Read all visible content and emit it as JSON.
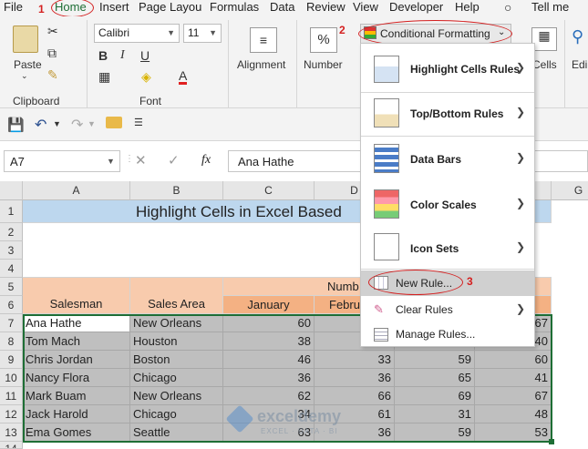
{
  "tabs": [
    {
      "label": "File"
    },
    {
      "label": "Home"
    },
    {
      "label": "Insert"
    },
    {
      "label": "Page Layou"
    },
    {
      "label": "Formulas"
    },
    {
      "label": "Data"
    },
    {
      "label": "Review"
    },
    {
      "label": "View"
    },
    {
      "label": "Developer"
    },
    {
      "label": "Help"
    },
    {
      "label": "Tell me"
    }
  ],
  "markers": {
    "m1": "1",
    "m2": "2",
    "m3": "3"
  },
  "ribbon": {
    "paste_label": "Paste",
    "clipboard_label": "Clipboard",
    "font_name": "Calibri",
    "font_size": "11",
    "bold": "B",
    "italic": "I",
    "underline": "U",
    "font_color_glyph": "A",
    "font_label": "Font",
    "alignment_label": "Alignment",
    "number_label": "Number",
    "percent_glyph": "%",
    "cf_button_label": "Conditional Formatting",
    "cells_label": "Cells",
    "editing_label": "Edi"
  },
  "formula_bar": {
    "name_box": "A7",
    "fx": "fx",
    "value": "Ana Hathe"
  },
  "columns": [
    "A",
    "B",
    "C",
    "D",
    "E",
    "F",
    "G"
  ],
  "rows": [
    "1",
    "2",
    "3",
    "4",
    "5",
    "6",
    "7",
    "8",
    "9",
    "10",
    "11",
    "12",
    "13",
    "14"
  ],
  "sheet": {
    "title": "Highlight Cells in Excel Based",
    "number_header": "Numb",
    "salesman_header": "Salesman",
    "area_header": "Sales Area",
    "january_header": "January",
    "february_header": "Febru",
    "data": [
      {
        "name": "Ana Hathe",
        "area": "New Orleans",
        "c": "60",
        "d": "",
        "e": "",
        "f": "67"
      },
      {
        "name": "Tom Mach",
        "area": "Houston",
        "c": "38",
        "d": "",
        "e": "",
        "f": "40"
      },
      {
        "name": "Chris Jordan",
        "area": "Boston",
        "c": "46",
        "d": "33",
        "e": "59",
        "f": "60"
      },
      {
        "name": "Nancy Flora",
        "area": "Chicago",
        "c": "36",
        "d": "36",
        "e": "65",
        "f": "41"
      },
      {
        "name": "Mark Buam",
        "area": "New Orleans",
        "c": "62",
        "d": "66",
        "e": "69",
        "f": "67"
      },
      {
        "name": "Jack Harold",
        "area": "Chicago",
        "c": "34",
        "d": "61",
        "e": "31",
        "f": "48"
      },
      {
        "name": "Ema Gomes",
        "area": "Seattle",
        "c": "63",
        "d": "36",
        "e": "59",
        "f": "53"
      }
    ]
  },
  "menu": {
    "items": [
      {
        "label": "Highlight Cells Rules"
      },
      {
        "label": "Top/Bottom Rules"
      },
      {
        "label": "Data Bars"
      },
      {
        "label": "Color Scales"
      },
      {
        "label": "Icon Sets"
      },
      {
        "label": "New Rule..."
      },
      {
        "label": "Clear Rules"
      },
      {
        "label": "Manage Rules..."
      }
    ]
  },
  "watermark": {
    "brand": "exceldemy",
    "tagline": "EXCEL · DATA · BI"
  },
  "colors": {
    "accent_green": "#1e6e35",
    "title_fill": "#bdd7ee",
    "header_fill": "#f8cbad",
    "selection_gray": "#bfbfbf",
    "annotation_red": "#d41f1f"
  }
}
